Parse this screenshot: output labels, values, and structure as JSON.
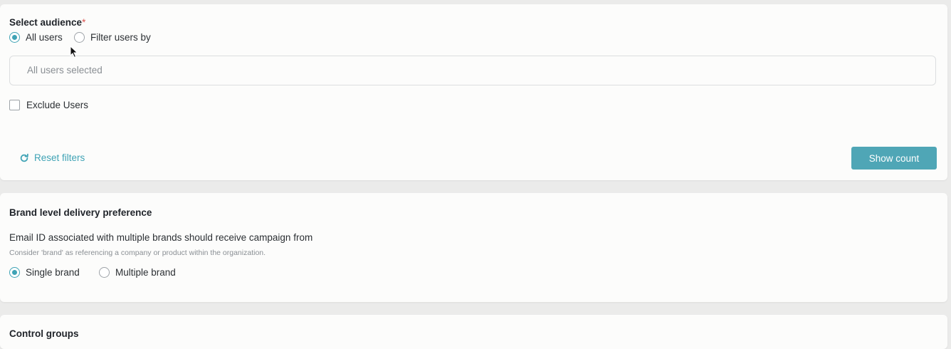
{
  "audience": {
    "title": "Select audience",
    "required_mark": "*",
    "options": [
      {
        "label": "All users",
        "selected": true
      },
      {
        "label": "Filter users by",
        "selected": false
      }
    ],
    "selection_summary": "All users selected",
    "exclude_label": "Exclude Users",
    "exclude_checked": false,
    "reset_label": "Reset filters",
    "reset_icon": "refresh-icon",
    "show_count_label": "Show count"
  },
  "brand_preference": {
    "title": "Brand level delivery preference",
    "question": "Email ID associated with multiple brands should receive campaign from",
    "hint": "Consider 'brand' as referencing a company or product within the organization.",
    "options": [
      {
        "label": "Single brand",
        "selected": true
      },
      {
        "label": "Multiple brand",
        "selected": false
      }
    ]
  },
  "control_groups": {
    "title": "Control groups"
  },
  "colors": {
    "accent": "#3fa3b5",
    "button_bg": "#4fa6b6",
    "required": "#d9534f",
    "page_bg": "#ebebea",
    "card_bg": "#fcfcfb"
  }
}
